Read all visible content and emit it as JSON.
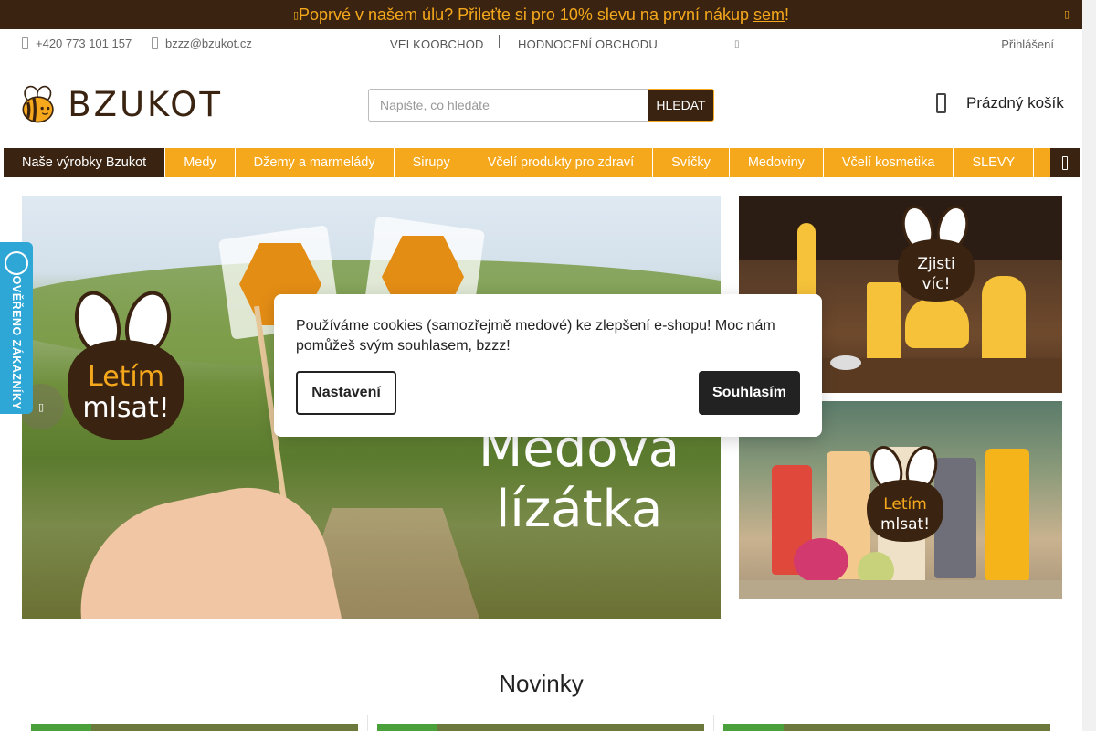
{
  "announcement": {
    "icon": "info-icon",
    "text": "Poprvé v našem úlu? Přileťte si pro 10% slevu na první nákup ",
    "link_text": "sem",
    "suffix": "!",
    "close_icon": "close-icon"
  },
  "topbar": {
    "phone": "+420 773 101 157",
    "email": "bzzz@bzukot.cz",
    "wholesale": "VELKOOBCHOD",
    "rating": "HODNOCENÍ OBCHODU",
    "login": "Přihlášení"
  },
  "header": {
    "logo_text": "BZUKOT",
    "search_placeholder": "Napište, co hledáte",
    "search_button": "HLEDAT",
    "cart_label": "Prázdný košík"
  },
  "nav": {
    "items": [
      {
        "label": "Naše výrobky Bzukot",
        "active": true
      },
      {
        "label": "Medy"
      },
      {
        "label": "Džemy a marmelády"
      },
      {
        "label": "Sirupy"
      },
      {
        "label": "Včelí produkty pro zdraví"
      },
      {
        "label": "Svíčky"
      },
      {
        "label": "Medoviny"
      },
      {
        "label": "Včelí kosmetika"
      },
      {
        "label": "SLEVY"
      }
    ]
  },
  "hero": {
    "badge_text": "Letím mlsat!",
    "title_line1": "Medová",
    "title_line2": "lízátka"
  },
  "side_banners": [
    {
      "badge_text": "Zjisti víc!"
    },
    {
      "badge_text": "Letím mlsat!"
    }
  ],
  "verified_badge": {
    "text": "OVĚŘENO ZÁKAZNÍKY"
  },
  "cookie": {
    "message": "Používáme cookies (samozřejmě medové) ke zlepšení e-shopu! Moc nám pomůžeš svým souhlasem, bzzz!",
    "settings_button": "Nastavení",
    "accept_button": "Souhlasím"
  },
  "section": {
    "title": "Novinky"
  },
  "colors": {
    "brand_dark": "#3a2411",
    "brand_orange": "#f6a81c",
    "verified_blue": "#2fa7d6"
  }
}
